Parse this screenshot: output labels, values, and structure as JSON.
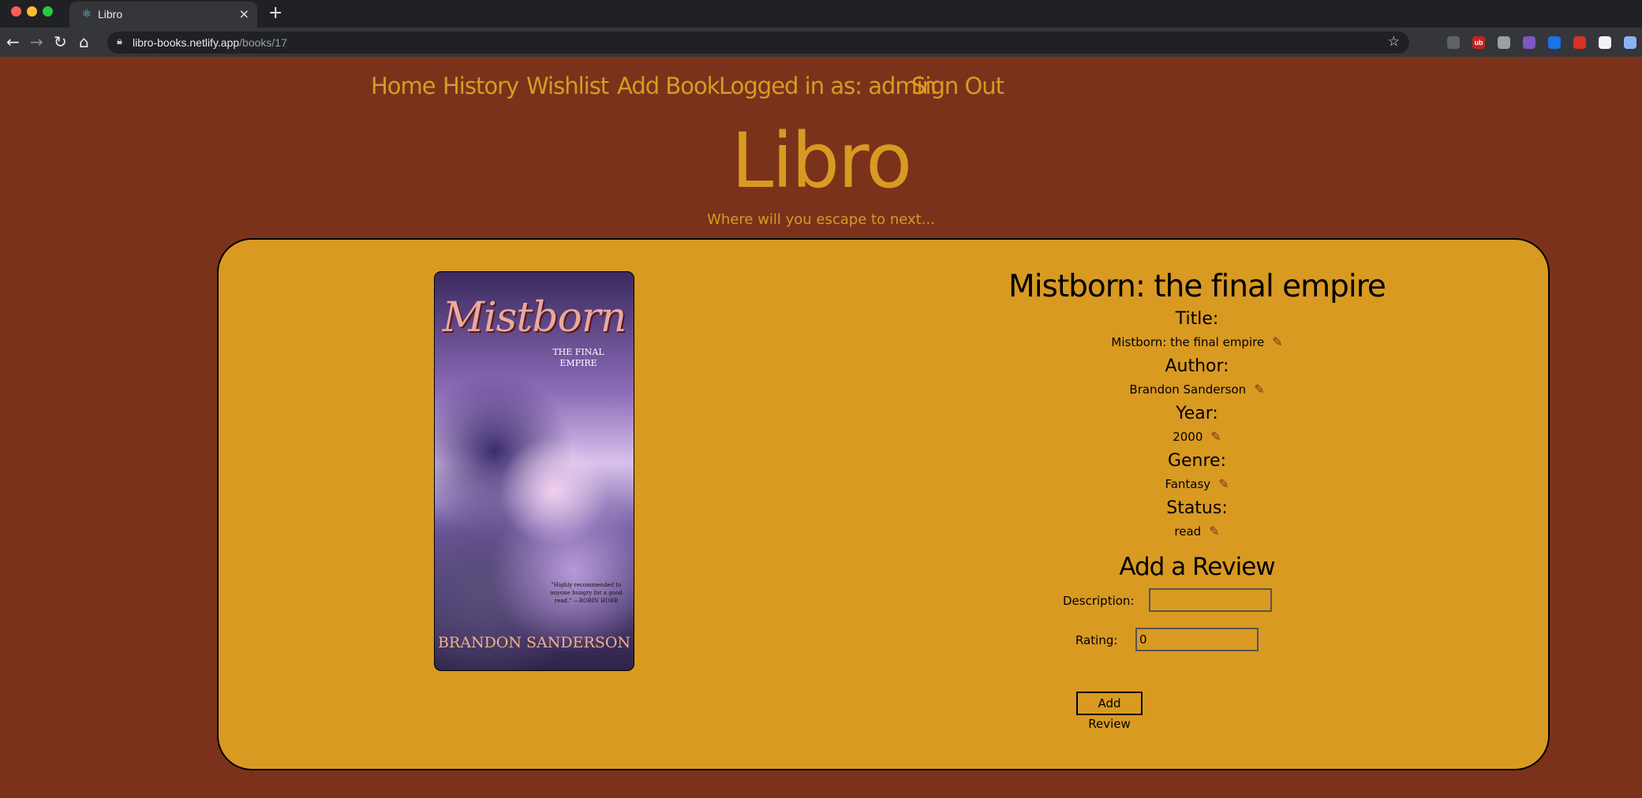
{
  "browser": {
    "tab_title": "Libro",
    "url_host": "libro-books.netlify.app",
    "url_path": "/books/17"
  },
  "nav": {
    "home": "Home",
    "history": "History",
    "wishlist": "Wishlist",
    "add_book": "Add Book",
    "logged_in": "Logged in as: admin",
    "sign_out": "Sign Out"
  },
  "brand": {
    "title": "Libro",
    "tagline": "Where will you escape to next..."
  },
  "book": {
    "heading": "Mistborn: the final empire",
    "fields": [
      {
        "label": "Title:",
        "value": "Mistborn: the final empire"
      },
      {
        "label": "Author:",
        "value": "Brandon Sanderson"
      },
      {
        "label": "Year:",
        "value": "2000"
      },
      {
        "label": "Genre:",
        "value": "Fantasy"
      },
      {
        "label": "Status:",
        "value": "read"
      }
    ],
    "cover": {
      "title": "Mistborn",
      "subtitle": "THE FINAL EMPIRE",
      "quote": "\"Highly recommended to anyone hungry for a good read.\" —ROBIN HOBB",
      "author": "BRANDON SANDERSON"
    }
  },
  "review": {
    "heading": "Add a Review",
    "description_label": "Description:",
    "description_value": "",
    "rating_label": "Rating:",
    "rating_value": "0",
    "submit_label": "Add Review"
  },
  "icons": {
    "edit": "pencil-icon"
  },
  "colors": {
    "background": "#7a321b",
    "accent": "#d99a22",
    "card": "#d99a22"
  }
}
